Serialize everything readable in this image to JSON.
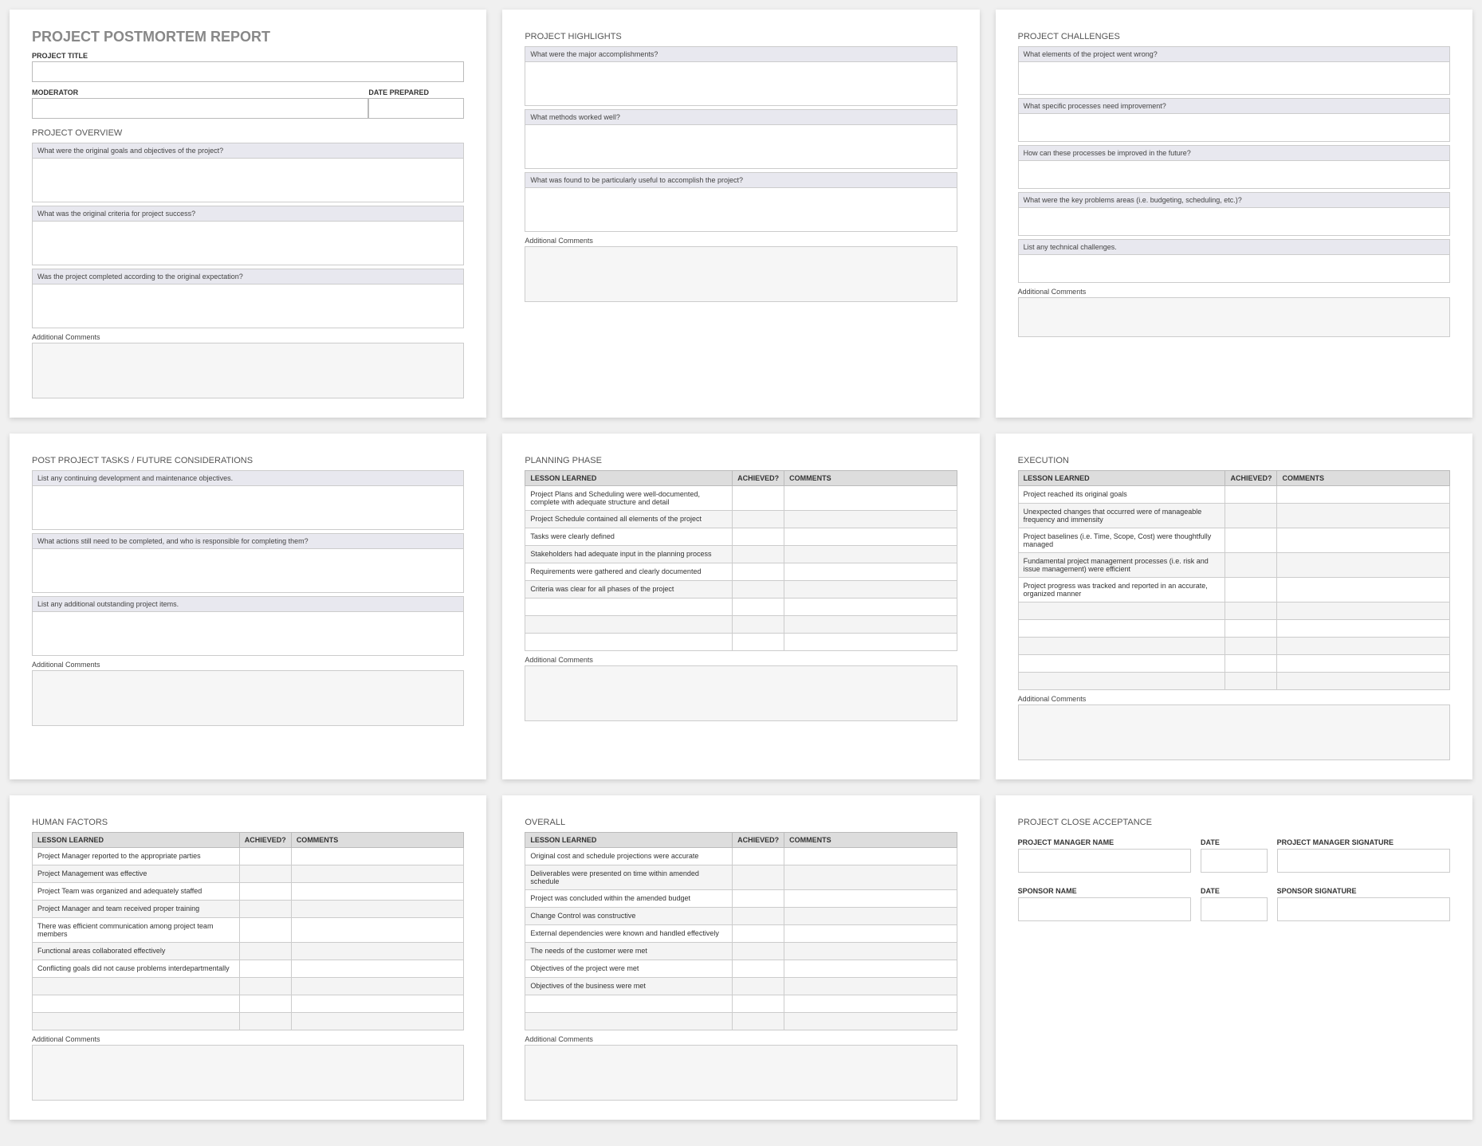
{
  "panels": {
    "p1": {
      "title": "PROJECT POSTMORTEM REPORT",
      "project_title_label": "PROJECT TITLE",
      "moderator_label": "MODERATOR",
      "date_prepared_label": "DATE PREPARED",
      "overview_title": "PROJECT OVERVIEW",
      "q1": "What were the original goals and objectives of the project?",
      "q2": "What was the original criteria for project success?",
      "q3": "Was the project completed according to the original expectation?",
      "comments": "Additional Comments"
    },
    "p2": {
      "title": "PROJECT HIGHLIGHTS",
      "q1": "What were the major accomplishments?",
      "q2": "What methods worked well?",
      "q3": "What was found to be particularly useful to accomplish the project?",
      "comments": "Additional Comments"
    },
    "p3": {
      "title": "PROJECT CHALLENGES",
      "q1": "What elements of the project went wrong?",
      "q2": "What specific processes need improvement?",
      "q3": "How can these processes be improved in the future?",
      "q4": "What were the key problems areas (i.e. budgeting, scheduling, etc.)?",
      "q5": "List any technical challenges.",
      "comments": "Additional Comments"
    },
    "p4": {
      "title": "POST PROJECT TASKS / FUTURE CONSIDERATIONS",
      "q1": "List any continuing development and maintenance objectives.",
      "q2": "What actions still need to be completed, and who is responsible for completing them?",
      "q3": "List any additional outstanding project items.",
      "comments": "Additional Comments"
    },
    "p5": {
      "title": "PLANNING PHASE",
      "th_lesson": "LESSON LEARNED",
      "th_ach": "ACHIEVED?",
      "th_com": "COMMENTS",
      "rows": [
        "Project Plans and Scheduling were well-documented, complete with adequate structure and detail",
        "Project Schedule contained all elements of the project",
        "Tasks were clearly defined",
        "Stakeholders had adequate input in the planning process",
        "Requirements were gathered and clearly documented",
        "Criteria was clear for all phases of the project",
        "",
        "",
        ""
      ],
      "comments": "Additional Comments"
    },
    "p6": {
      "title": "EXECUTION",
      "th_lesson": "LESSON LEARNED",
      "th_ach": "ACHIEVED?",
      "th_com": "COMMENTS",
      "rows": [
        "Project reached its original goals",
        "Unexpected changes that occurred were of manageable frequency and immensity",
        "Project baselines (i.e. Time, Scope, Cost) were thoughtfully managed",
        "Fundamental project management processes (i.e. risk and issue management) were efficient",
        "Project progress was tracked and reported in an accurate, organized manner",
        "",
        "",
        "",
        "",
        ""
      ],
      "comments": "Additional Comments"
    },
    "p7": {
      "title": "HUMAN FACTORS",
      "th_lesson": "LESSON LEARNED",
      "th_ach": "ACHIEVED?",
      "th_com": "COMMENTS",
      "rows": [
        "Project Manager reported to the appropriate parties",
        "Project Management was effective",
        "Project Team was organized and adequately staffed",
        "Project Manager and team received proper training",
        "There was efficient communication among project team members",
        "Functional areas collaborated effectively",
        "Conflicting goals did not cause problems interdepartmentally",
        "",
        "",
        ""
      ],
      "comments": "Additional Comments"
    },
    "p8": {
      "title": "OVERALL",
      "th_lesson": "LESSON LEARNED",
      "th_ach": "ACHIEVED?",
      "th_com": "COMMENTS",
      "rows": [
        "Original cost and schedule projections were accurate",
        "Deliverables were presented on time within amended schedule",
        "Project was concluded within the amended budget",
        "Change Control was constructive",
        "External dependencies were known and handled effectively",
        "The needs of the customer were met",
        "Objectives of the project were met",
        "Objectives of the business were met",
        "",
        ""
      ],
      "comments": "Additional Comments"
    },
    "p9": {
      "title": "PROJECT CLOSE ACCEPTANCE",
      "pm_name": "PROJECT MANAGER NAME",
      "pm_date": "DATE",
      "pm_sig": "PROJECT MANAGER SIGNATURE",
      "sp_name": "SPONSOR NAME",
      "sp_date": "DATE",
      "sp_sig": "SPONSOR SIGNATURE"
    }
  }
}
